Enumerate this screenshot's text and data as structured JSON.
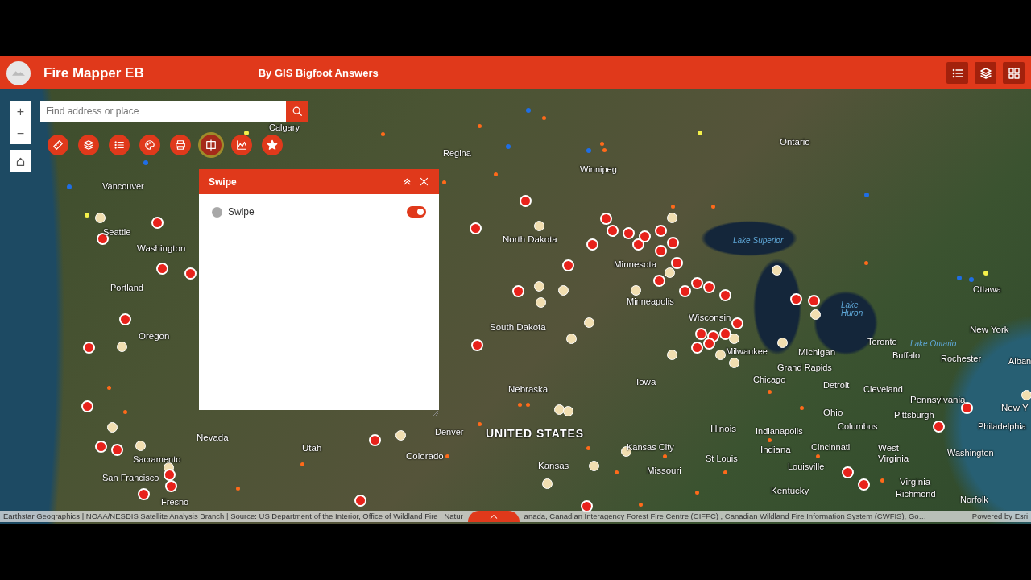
{
  "header": {
    "title": "Fire Mapper EB",
    "subtitle": "By GIS Bigfoot Answers",
    "buttons": [
      {
        "kind": "legend"
      },
      {
        "kind": "layers"
      },
      {
        "kind": "widgets"
      }
    ]
  },
  "search": {
    "placeholder": "Find address or place"
  },
  "zoom": {
    "in": "+",
    "out": "−"
  },
  "tools": [
    {
      "kind": "measure",
      "selected": false
    },
    {
      "kind": "layers",
      "selected": false
    },
    {
      "kind": "list",
      "selected": false
    },
    {
      "kind": "palette",
      "selected": false
    },
    {
      "kind": "print",
      "selected": false
    },
    {
      "kind": "swipe",
      "selected": true
    },
    {
      "kind": "chart",
      "selected": false
    },
    {
      "kind": "star",
      "selected": false
    }
  ],
  "swipe_panel": {
    "title": "Swipe",
    "items": [
      {
        "label": "Swipe",
        "on": true
      }
    ]
  },
  "map_labels": [
    {
      "text": "Calgary",
      "kind": "city"
    },
    {
      "text": "Regina",
      "kind": "city"
    },
    {
      "text": "Winnipeg",
      "kind": "city"
    },
    {
      "text": "Ontario",
      "kind": "region"
    },
    {
      "text": "Vancouver",
      "kind": "city"
    },
    {
      "text": "Seattle",
      "kind": "city"
    },
    {
      "text": "Washington",
      "kind": "region"
    },
    {
      "text": "Portland",
      "kind": "city"
    },
    {
      "text": "Oregon",
      "kind": "region"
    },
    {
      "text": "North Dakota",
      "kind": "region"
    },
    {
      "text": "Minnesota",
      "kind": "region"
    },
    {
      "text": "Lake Superior",
      "kind": "water"
    },
    {
      "text": "Minneapolis",
      "kind": "city"
    },
    {
      "text": "Wisconsin",
      "kind": "region"
    },
    {
      "text": "South Dakota",
      "kind": "region"
    },
    {
      "text": "Milwaukee",
      "kind": "city"
    },
    {
      "text": "Michigan",
      "kind": "region"
    },
    {
      "text": "Lake Huron",
      "kind": "water"
    },
    {
      "text": "Toronto",
      "kind": "city"
    },
    {
      "text": "Lake Ontario",
      "kind": "water"
    },
    {
      "text": "Ottawa",
      "kind": "city"
    },
    {
      "text": "New York",
      "kind": "region"
    },
    {
      "text": "Buffalo",
      "kind": "city"
    },
    {
      "text": "Rochester",
      "kind": "city"
    },
    {
      "text": "Alban",
      "kind": "city"
    },
    {
      "text": "Grand Rapids",
      "kind": "city"
    },
    {
      "text": "Chicago",
      "kind": "city"
    },
    {
      "text": "Detroit",
      "kind": "city"
    },
    {
      "text": "Cleveland",
      "kind": "city"
    },
    {
      "text": "Iowa",
      "kind": "region"
    },
    {
      "text": "Nebraska",
      "kind": "region"
    },
    {
      "text": "Denver",
      "kind": "city"
    },
    {
      "text": "UNITED STATES",
      "kind": "country"
    },
    {
      "text": "Colorado",
      "kind": "region"
    },
    {
      "text": "Nevada",
      "kind": "region"
    },
    {
      "text": "Utah",
      "kind": "region"
    },
    {
      "text": "Sacramento",
      "kind": "city"
    },
    {
      "text": "San Francisco",
      "kind": "city"
    },
    {
      "text": "Fresno",
      "kind": "city"
    },
    {
      "text": "Kansas City",
      "kind": "city"
    },
    {
      "text": "Kansas",
      "kind": "region"
    },
    {
      "text": "Missouri",
      "kind": "region"
    },
    {
      "text": "Illinois",
      "kind": "region"
    },
    {
      "text": "Indianapolis",
      "kind": "city"
    },
    {
      "text": "Indiana",
      "kind": "region"
    },
    {
      "text": "St Louis",
      "kind": "city"
    },
    {
      "text": "Ohio",
      "kind": "region"
    },
    {
      "text": "Columbus",
      "kind": "city"
    },
    {
      "text": "Pennsylvania",
      "kind": "region"
    },
    {
      "text": "Pittsburgh",
      "kind": "city"
    },
    {
      "text": "Cincinnati",
      "kind": "city"
    },
    {
      "text": "West Virginia",
      "kind": "region"
    },
    {
      "text": "Louisville",
      "kind": "city"
    },
    {
      "text": "Kentucky",
      "kind": "region"
    },
    {
      "text": "Virginia",
      "kind": "region"
    },
    {
      "text": "Richmond",
      "kind": "city"
    },
    {
      "text": "Washington",
      "kind": "city"
    },
    {
      "text": "New Y",
      "kind": "region"
    },
    {
      "text": "Philadelphia",
      "kind": "city"
    },
    {
      "text": "Norfolk",
      "kind": "city"
    }
  ],
  "attribution": {
    "left": "Earthstar Geographics | NOAA/NESDIS Satellite Analysis Branch | Source: US Department of the Interior, Office of Wildland Fire | Natur",
    "right": "anada, Canadian Interagency Forest Fire Centre (CIFFC) , Canadian Wildland Fire Information System (CWFIS), Go…",
    "powered_by": "Powered by Esri"
  }
}
